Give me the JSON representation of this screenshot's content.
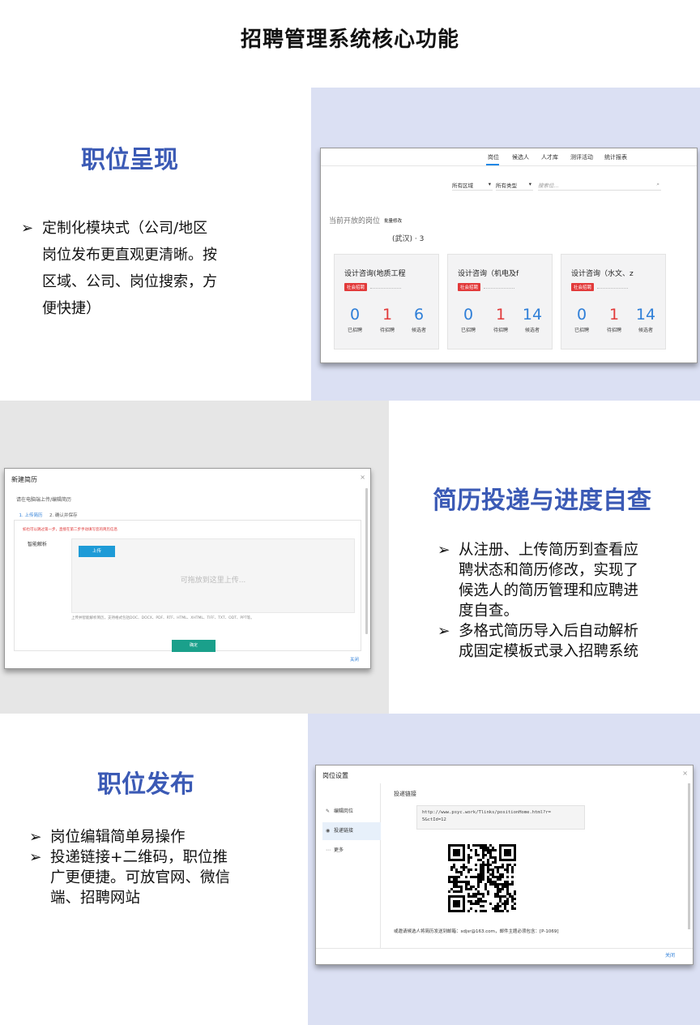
{
  "page_title": "招聘管理系统核心功能",
  "section1": {
    "heading": "职位呈现",
    "bullets": [
      "定制化模块式（公司/地区岗位发布更直观更清晰。按区域、公司、岗位搜索，方便快捷）"
    ],
    "bullet_lines": [
      [
        "定制化模块式（公司/地区",
        "岗位发布更直观更清晰。按",
        "区域、公司、岗位搜索，方",
        "便快捷）"
      ]
    ],
    "app": {
      "nav": [
        "岗位",
        "候选人",
        "人才库",
        "测评活动",
        "统计报表"
      ],
      "filter_region": "所有区域",
      "filter_type": "所有类型",
      "search_placeholder": "搜索位...",
      "current_label": "当前开放的岗位",
      "batch_edit": "批量修改",
      "location": "(武汉) · 3",
      "cards": [
        {
          "title": "设计咨询(地质工程",
          "badge": "社会招聘",
          "hired": "0",
          "pending": "1",
          "candidates": "6"
        },
        {
          "title": "设计咨询（机电及f",
          "badge": "社会招聘",
          "hired": "0",
          "pending": "1",
          "candidates": "14"
        },
        {
          "title": "设计咨询（水文、z",
          "badge": "社会招聘",
          "hired": "0",
          "pending": "1",
          "candidates": "14"
        }
      ],
      "stat_labels": [
        "已招聘",
        "待招聘",
        "候选者"
      ]
    }
  },
  "section2": {
    "heading": "简历投递与进度自查",
    "bullet_lines": [
      [
        "从注册、上传简历到查看应",
        "聘状态和简历修改，实现了",
        "候选人的简历管理和应聘进",
        "度自查。"
      ],
      [
        "多格式简历导入后自动解析",
        "成固定模板式录入招聘系统"
      ]
    ],
    "dialog": {
      "title": "新建简历",
      "close": "×",
      "subtitle": "请在电脑端上传/编辑简历",
      "tab1": "1. 上传简历",
      "tab2": "2. 确认并保存",
      "warning": "如也可以跳过第一步，直接在第二步手动填写您的简历信息",
      "parse_label": "智能解析",
      "upload_button": "上传",
      "drop_text": "可拖放到这里上传...",
      "hint": "上传并智能解析简历，支持格式包括DOC、DOCX、PDF、RTF、HTML、XHTML、TIFF、TXT、ODT、PPT等。",
      "ok_button": "确定",
      "footer_close": "关闭"
    }
  },
  "section3": {
    "heading": "职位发布",
    "bullet_lines": [
      [
        "岗位编辑简单易操作"
      ],
      [
        "投递链接+二维码，职位推",
        "广更便捷。可放官网、微信",
        "端、招聘网站"
      ]
    ],
    "dialog": {
      "title": "岗位设置",
      "close": "×",
      "menu": [
        {
          "icon": "edit-icon",
          "label": "编辑岗位"
        },
        {
          "icon": "eye-icon",
          "label": "投递链接"
        },
        {
          "icon": "more-icon",
          "label": "更多"
        }
      ],
      "section_label": "投递链接",
      "link_line1": "http://www.psyc.work/Tlinks/positionHome.html?r=",
      "link_line2": "5&ctId=12",
      "mail_text": "或邀请候选人将简历发送到邮箱：sdjsr@163.com，邮件主题必须包含：[P-1069]",
      "footer_close": "关闭"
    }
  },
  "colors": {
    "heading": "#3b5ab5",
    "panel_bg": "#dbe0f3",
    "accent_blue": "#2f7fd8",
    "accent_red": "#e23a3a",
    "ok_green": "#1aa08b"
  }
}
